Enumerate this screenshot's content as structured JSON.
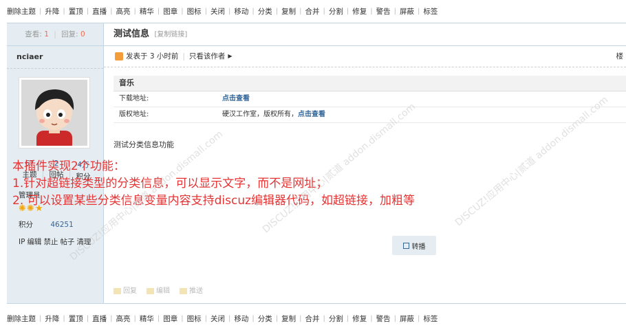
{
  "modbar": {
    "items": [
      "删除主题",
      "升降",
      "置顶",
      "直播",
      "高亮",
      "精华",
      "图章",
      "图标",
      "关闭",
      "移动",
      "分类",
      "复制",
      "合并",
      "分割",
      "修复",
      "警告",
      "屏蔽",
      "标签"
    ]
  },
  "side": {
    "views_label": "查看:",
    "views_value": "1",
    "replies_label": "回复:",
    "replies_value": "0",
    "author": "nciaer",
    "stats": [
      {
        "value": "67",
        "label": "主题"
      },
      {
        "value": "2",
        "label": "回帖"
      },
      {
        "value": "4万",
        "label": "积分"
      }
    ],
    "group": "管理员",
    "credits_label": "积分",
    "credits_value": "46251",
    "links": [
      "IP",
      "编辑",
      "禁止",
      "帖子",
      "清理"
    ]
  },
  "post": {
    "title": "测试信息",
    "copy_link": "[复制链接]",
    "posted": "发表于 3 小时前",
    "only_author": "只看该作者",
    "right_mark": "楼",
    "type_name": "音乐",
    "rows": [
      {
        "key": "下载地址:",
        "value": "",
        "link": "点击查看"
      },
      {
        "key": "版权地址:",
        "value": "硬汉工作室，版权所有，",
        "link": "点击查看"
      }
    ],
    "content": "测试分类信息功能",
    "share": "转播",
    "actions": [
      "回复",
      "编辑",
      "推送"
    ]
  },
  "notes": [
    "本插件实现2个功能：",
    "1.针对超链接类型的分类信息，可以显示文字，而不是网址；",
    "2. 可以设置某些分类信息变量内容支持discuz编辑器代码，如超链接，加粗等"
  ],
  "watermark": "DISCUZ!应用中心|贰道 addon.dismall.com",
  "colors": {
    "accent": "#336699",
    "note": "#e53333",
    "side_bg": "#e5edf2",
    "star": "#f4a60a"
  }
}
